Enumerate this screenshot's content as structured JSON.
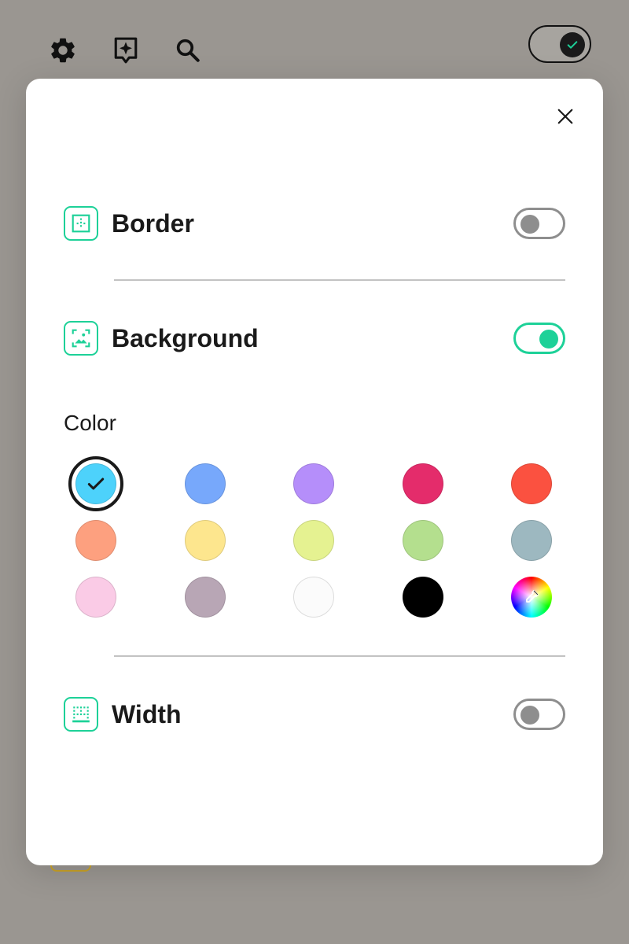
{
  "toolbar": {
    "icons": [
      "gear-icon",
      "ai-sparkle-icon",
      "search-icon"
    ]
  },
  "theme_toggle": {
    "state": "dark",
    "icon": "check-icon"
  },
  "modal": {
    "close_icon": "close-icon",
    "sections": {
      "border": {
        "label": "Border",
        "icon": "border-icon",
        "enabled": false
      },
      "background": {
        "label": "Background",
        "icon": "background-image-icon",
        "enabled": true
      },
      "width": {
        "label": "Width",
        "icon": "width-icon",
        "enabled": false
      }
    },
    "color": {
      "heading": "Color",
      "selected_index": 0,
      "swatches": [
        {
          "name": "sky-blue",
          "hex": "#4dd2fb"
        },
        {
          "name": "blue",
          "hex": "#77a8fb"
        },
        {
          "name": "purple",
          "hex": "#b58efa"
        },
        {
          "name": "magenta",
          "hex": "#e42c6b"
        },
        {
          "name": "red",
          "hex": "#fb5140"
        },
        {
          "name": "orange",
          "hex": "#fda07f"
        },
        {
          "name": "yellow",
          "hex": "#fde68e"
        },
        {
          "name": "lime",
          "hex": "#e5f291"
        },
        {
          "name": "green",
          "hex": "#b4df8e"
        },
        {
          "name": "slate",
          "hex": "#9db8c0"
        },
        {
          "name": "pink",
          "hex": "#facbe6"
        },
        {
          "name": "mauve",
          "hex": "#b8a6b5"
        },
        {
          "name": "white",
          "hex": "#fbfbfb"
        },
        {
          "name": "black",
          "hex": "#000000"
        },
        {
          "name": "custom-picker",
          "hex": "rainbow"
        }
      ]
    }
  },
  "colors": {
    "accent": "#1dd198",
    "switch_off": "#8e8e8e",
    "backdrop": "#9a9691",
    "divider": "#c3c3c3"
  }
}
